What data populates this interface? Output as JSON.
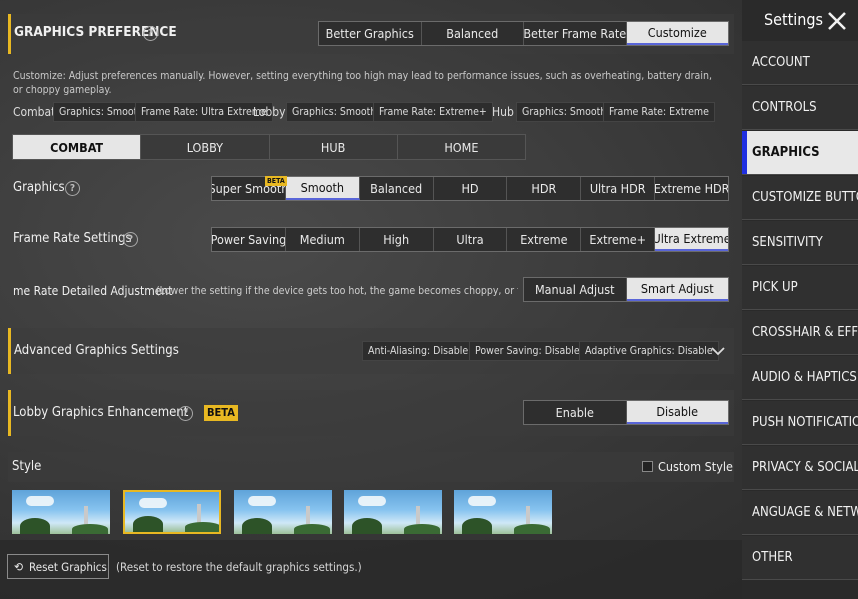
{
  "header": {
    "title": "GRAPHICS PREFERENCE",
    "preference_options": [
      "Better Graphics",
      "Balanced",
      "Better Frame Rate",
      "Customize"
    ],
    "selected_preference": "Customize"
  },
  "description": "Customize: Adjust preferences manually. However, setting everything too high may lead to performance issues, such as overheating, battery drain, or choppy gameplay.",
  "summary": {
    "combat_label": "Combat",
    "combat_graphics": "Graphics: Smooth",
    "combat_framerate": "Frame Rate: Ultra Extreme",
    "lobby_label": "Lobby",
    "lobby_graphics": "Graphics: Smooth",
    "lobby_framerate": "Frame Rate: Extreme+",
    "hub_label": "Hub",
    "hub_graphics": "Graphics: Smooth",
    "hub_framerate": "Frame Rate: Extreme"
  },
  "mode_tabs": [
    "COMBAT",
    "LOBBY",
    "HUB",
    "HOME"
  ],
  "selected_mode": "COMBAT",
  "graphics": {
    "label": "Graphics",
    "options": [
      "Super Smooth",
      "Smooth",
      "Balanced",
      "HD",
      "HDR",
      "Ultra HDR",
      "Extreme HDR"
    ],
    "selected": "Smooth",
    "beta_badge": "BETA"
  },
  "frame_rate": {
    "label": "Frame Rate Settings",
    "options": [
      "Power Saving",
      "Medium",
      "High",
      "Ultra",
      "Extreme",
      "Extreme+",
      "Ultra Extreme"
    ],
    "selected": "Ultra Extreme"
  },
  "detailed": {
    "label": "me Rate Detailed Adjustment",
    "hint": "(Lower the setting if the device gets too hot, the game becomes choppy, or the batt",
    "options": [
      "Manual Adjust",
      "Smart Adjust"
    ],
    "selected": "Smart Adjust"
  },
  "advanced": {
    "label": "Advanced Graphics Settings",
    "chips": [
      "Anti-Aliasing: Disable",
      "Power Saving: Disable",
      "Adaptive Graphics: Disable"
    ]
  },
  "lobby_enh": {
    "label": "Lobby Graphics Enhancement",
    "beta": "BETA",
    "options": [
      "Enable",
      "Disable"
    ],
    "selected": "Disable"
  },
  "style": {
    "label": "Style",
    "custom_label": "Custom Style",
    "selected_index": 1
  },
  "reset": {
    "label": "Reset Graphics",
    "hint": "(Reset to restore the default graphics settings.)"
  },
  "sidebar": {
    "title": "Settings",
    "items": [
      "ACCOUNT",
      "CONTROLS",
      "GRAPHICS",
      "CUSTOMIZE BUTTONS",
      "SENSITIVITY",
      "PICK UP",
      "CROSSHAIR & EFFEC",
      "AUDIO & HAPTICS",
      "PUSH NOTIFICATIONS",
      "PRIVACY & SOCIAL",
      "ANGUAGE & NETWOR",
      "OTHER"
    ],
    "selected": "GRAPHICS"
  },
  "colors": {
    "accent_yellow": "#e8b822",
    "selection_blue": "#1f2fe0"
  }
}
